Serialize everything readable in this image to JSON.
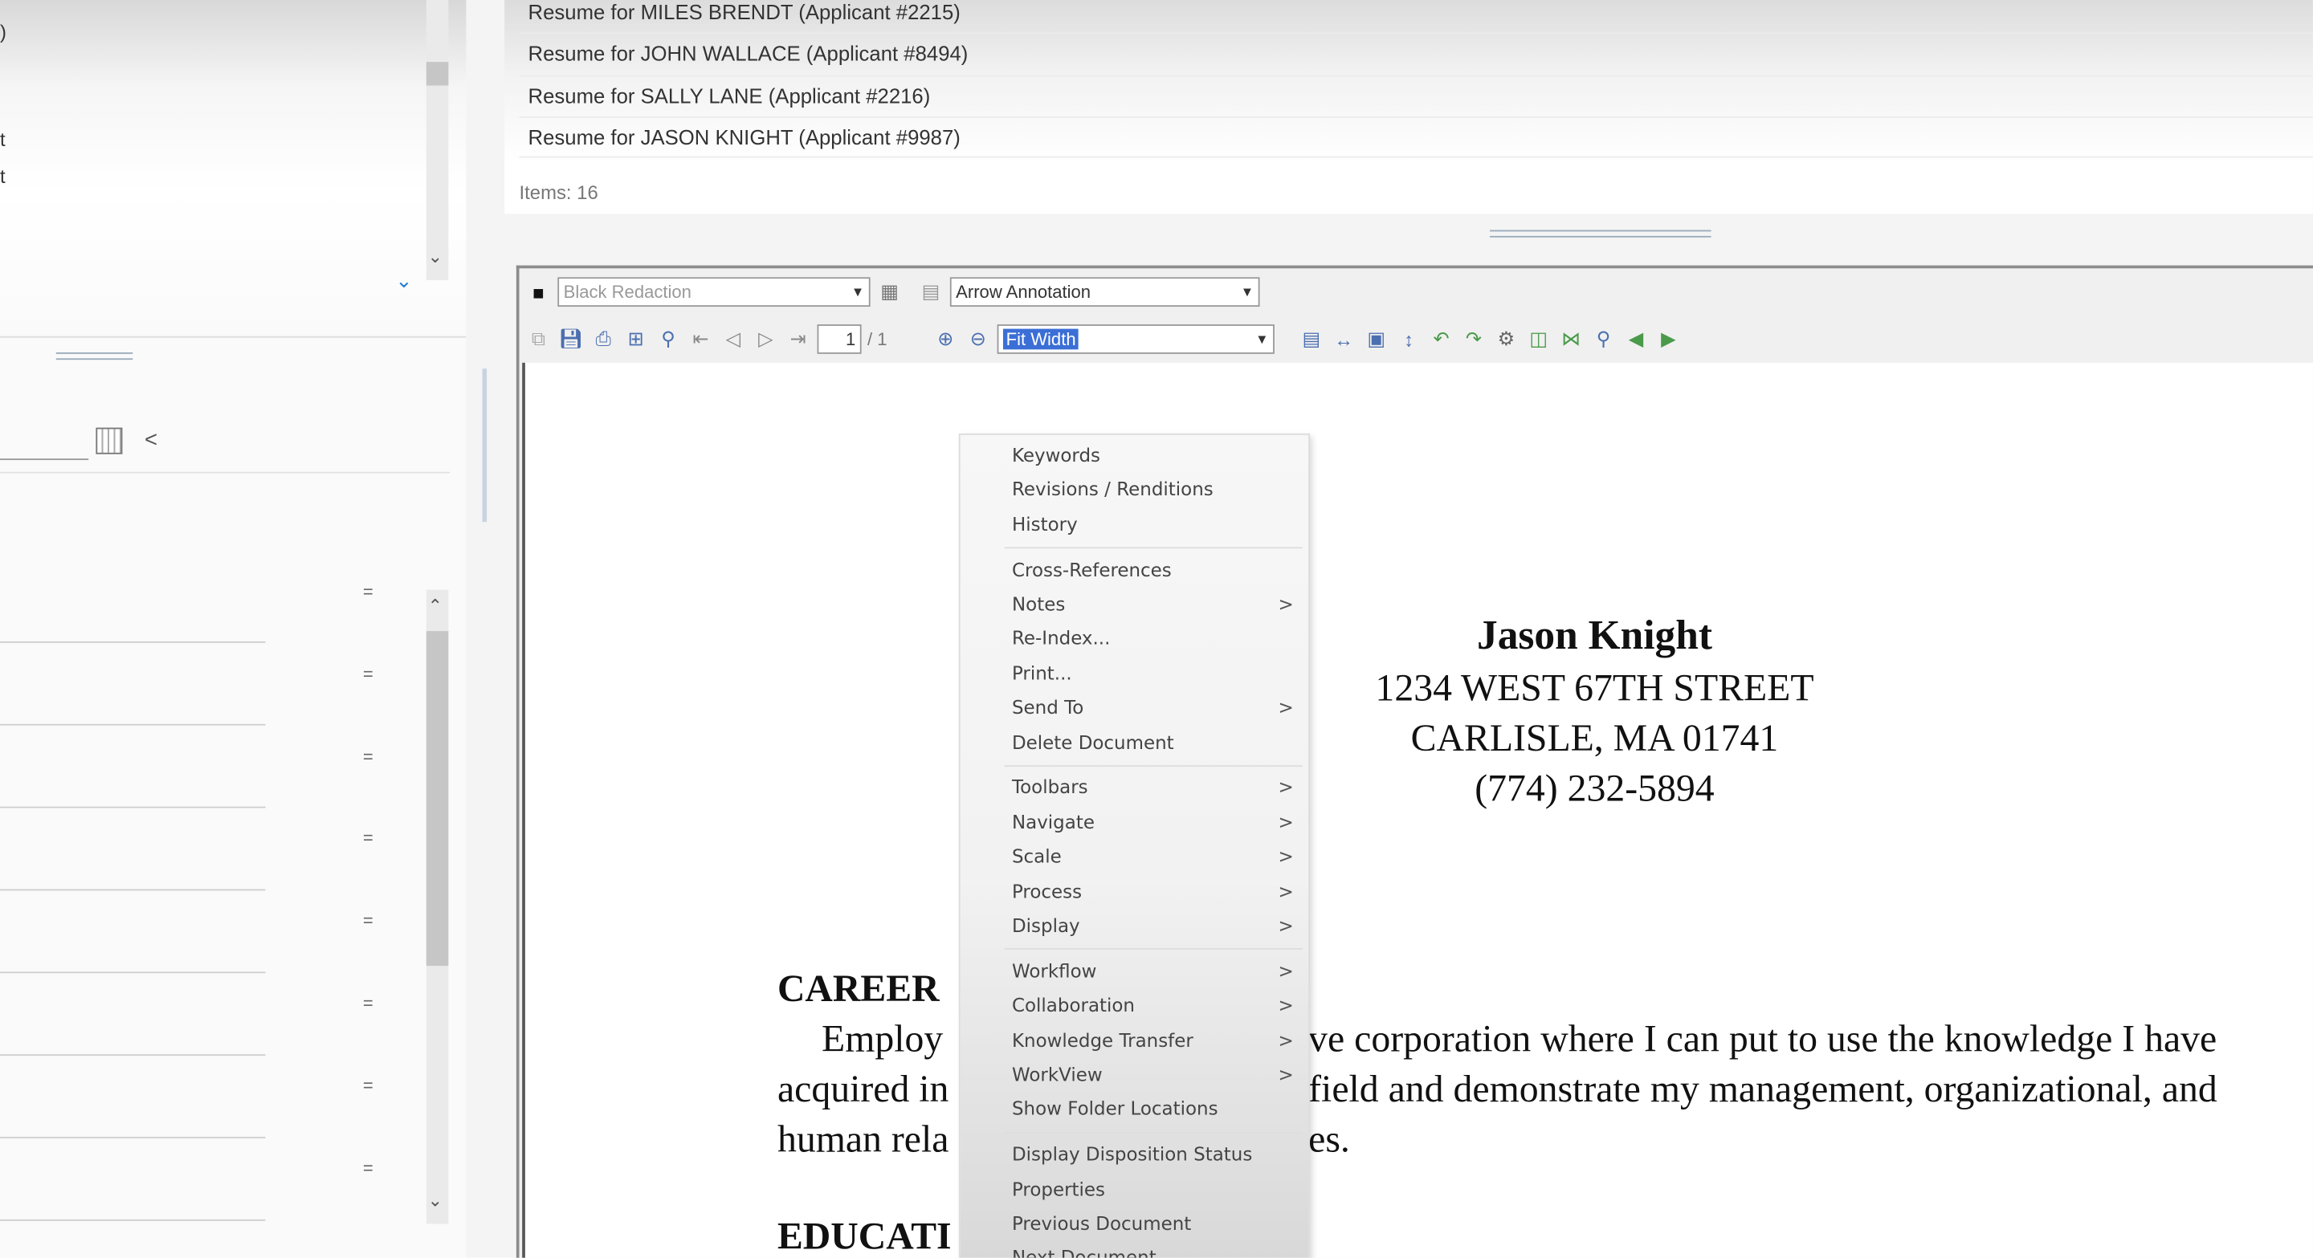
{
  "left_pane": {
    "partial_texts": [
      ")",
      "t",
      "t"
    ],
    "row_markers": [
      "=",
      "=",
      "=",
      "=",
      "=",
      "=",
      "=",
      "="
    ]
  },
  "document_list": {
    "items": [
      "Resume for MILES BRENDT (Applicant #2215)",
      "Resume for JOHN WALLACE (Applicant #8494)",
      "Resume for SALLY LANE (Applicant #2216)",
      "Resume for JASON KNIGHT (Applicant #9987)"
    ],
    "count_label": "Items: 16"
  },
  "toolbar": {
    "redaction_select": "Black Redaction",
    "annotation_select": "Arrow Annotation",
    "page_input": "1",
    "page_total": "/ 1",
    "zoom_select": "Fit Width",
    "selection_color": "#3b6fd6"
  },
  "document": {
    "name": "Jason Knight",
    "address1": "1234 WEST 67TH STREET",
    "address2": "CARLISLE, MA 01741",
    "phone": "(774) 232-5894",
    "section1": "CAREER",
    "para_lines_left": [
      "Employ",
      "acquired in",
      "human rela"
    ],
    "para_lines_right": [
      "ve corporation where I can put to use the knowledge I have",
      "field and demonstrate my management, organizational, and",
      "es."
    ],
    "section2": "EDUCATI"
  },
  "context_menu": {
    "items": [
      {
        "label": "Keywords",
        "submenu": false
      },
      {
        "label": "Revisions / Renditions",
        "submenu": false
      },
      {
        "label": "History",
        "submenu": false
      },
      {
        "label": "Cross-References",
        "submenu": false
      },
      {
        "label": "Notes",
        "submenu": true
      },
      {
        "label": "Re-Index...",
        "submenu": false
      },
      {
        "label": "Print...",
        "submenu": false
      },
      {
        "label": "Send To",
        "submenu": true
      },
      {
        "label": "Delete Document",
        "submenu": false
      },
      {
        "label": "Toolbars",
        "submenu": true
      },
      {
        "label": "Navigate",
        "submenu": true
      },
      {
        "label": "Scale",
        "submenu": true
      },
      {
        "label": "Process",
        "submenu": true
      },
      {
        "label": "Display",
        "submenu": true
      },
      {
        "label": "Workflow",
        "submenu": true
      },
      {
        "label": "Collaboration",
        "submenu": true
      },
      {
        "label": "Knowledge Transfer",
        "submenu": true
      },
      {
        "label": "WorkView",
        "submenu": true
      },
      {
        "label": "Show Folder Locations",
        "submenu": false
      },
      {
        "label": "Display Disposition Status",
        "submenu": false
      },
      {
        "label": "Properties",
        "submenu": false
      },
      {
        "label": "Previous Document",
        "submenu": false
      },
      {
        "label": "Next Document",
        "submenu": false
      }
    ],
    "submenu_glyph": ">"
  }
}
